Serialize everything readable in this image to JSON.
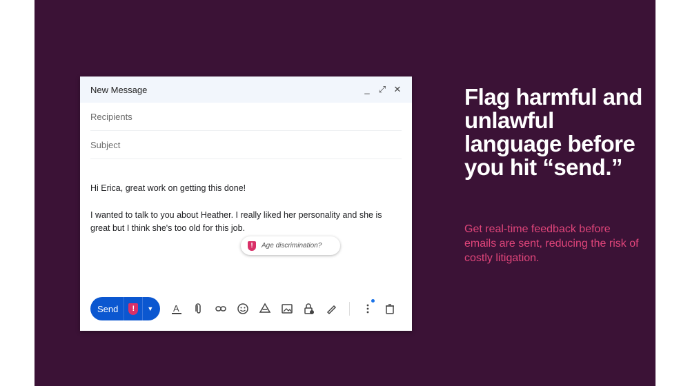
{
  "compose": {
    "title": "New Message",
    "window_controls": [
      "minimize-icon",
      "expand-icon",
      "close-icon"
    ],
    "recipients_placeholder": "Recipients",
    "subject_placeholder": "Subject",
    "body": {
      "greeting": "Hi Erica, great work on getting this done!",
      "paragraph": "I wanted to talk to you about Heather. I really liked her personality and she is great but I think she's too old for this job."
    },
    "flag": {
      "icon": "shield-exclamation-icon",
      "label": "Age discrimination?"
    },
    "toolbar": {
      "send_label": "Send",
      "tools": [
        "text-format-icon",
        "attach-icon",
        "link-icon",
        "emoji-icon",
        "drive-icon",
        "image-icon",
        "lock-clock-icon",
        "signature-pen-icon",
        "more-options-icon",
        "trash-icon"
      ]
    }
  },
  "promo": {
    "headline": "Flag harmful and unlawful language before you hit “send.”",
    "subtext": "Get real-time feedback before emails are sent, reducing the risk of costly litigation."
  },
  "colors": {
    "background": "#3b1236",
    "accent_pink": "#e0457a",
    "send_blue": "#0b57d0",
    "flag_red": "#d93068"
  }
}
